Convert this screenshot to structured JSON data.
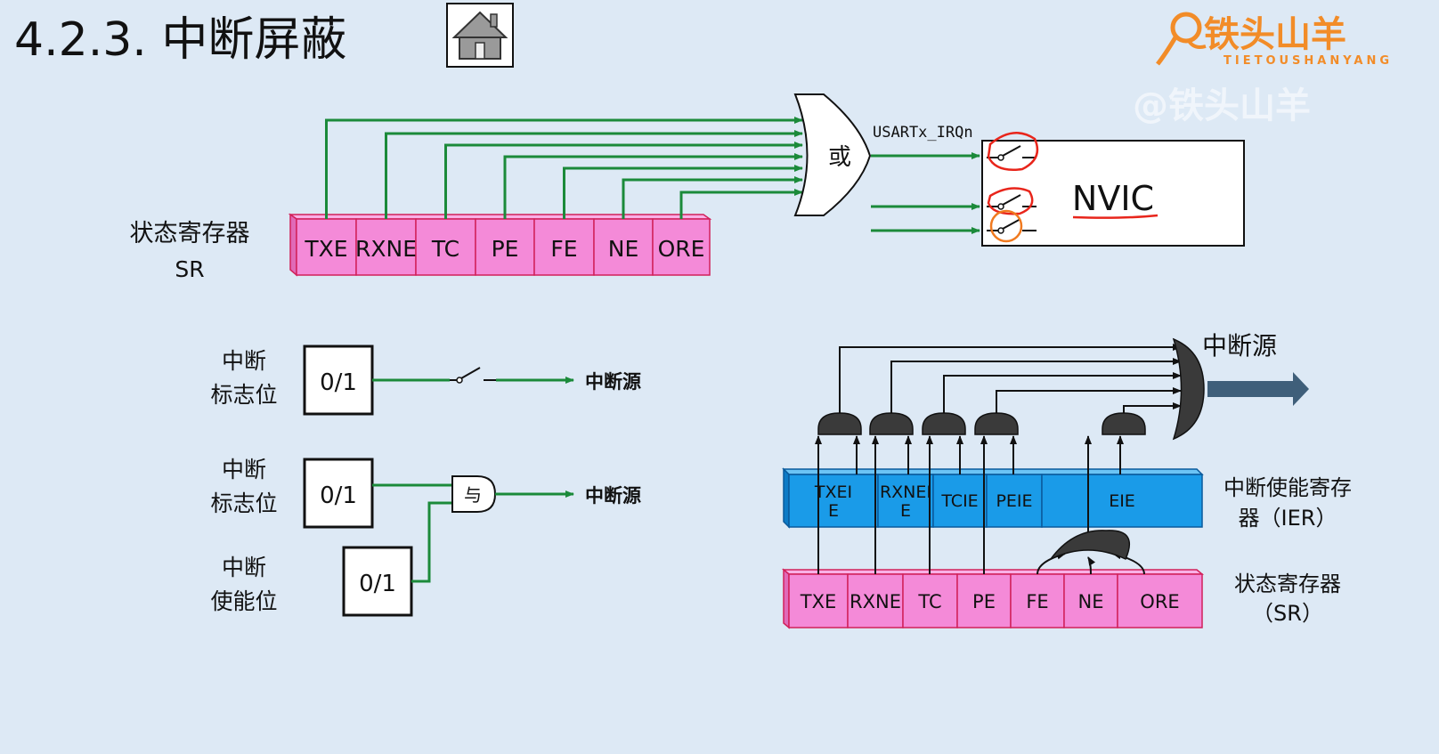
{
  "title": "4.2.3.  中断屏蔽",
  "logo": {
    "main": "铁头山羊",
    "sub": "TIETOUSHANYANG",
    "watermark": "@铁头山羊"
  },
  "top_diagram": {
    "register_label": "状态寄存器",
    "register_abbr": "SR",
    "bits": [
      "TXE",
      "RXNE",
      "TC",
      "PE",
      "FE",
      "NE",
      "ORE"
    ],
    "or_gate": "或",
    "irq_label": "USARTx_IRQn",
    "nvic": "NVIC"
  },
  "example1": {
    "flag_label_1": "中断",
    "flag_label_2": "标志位",
    "value": "0/1",
    "output": "中断源"
  },
  "example2": {
    "flag_label_1": "中断",
    "flag_label_2": "标志位",
    "flag_value": "0/1",
    "enable_label_1": "中断",
    "enable_label_2": "使能位",
    "enable_value": "0/1",
    "and_gate": "与",
    "output": "中断源"
  },
  "right_diagram": {
    "output": "中断源",
    "ier_cells": [
      "TXEI\nE",
      "RXNEI\nE",
      "TCIE",
      "PEIE",
      "EIE"
    ],
    "ier_label_1": "中断使能寄存",
    "ier_label_2": "器（IER）",
    "sr_bits": [
      "TXE",
      "RXNE",
      "TC",
      "PE",
      "FE",
      "NE",
      "ORE"
    ],
    "sr_label_1": "状态寄存器",
    "sr_label_2": "（SR）"
  },
  "colors": {
    "green": "#1b8a3a",
    "pink": "#f48ad8",
    "pink_border": "#d2215a",
    "blue": "#1a9be8",
    "red": "#e8251b",
    "orange": "#f07a20",
    "gate": "#333333"
  }
}
